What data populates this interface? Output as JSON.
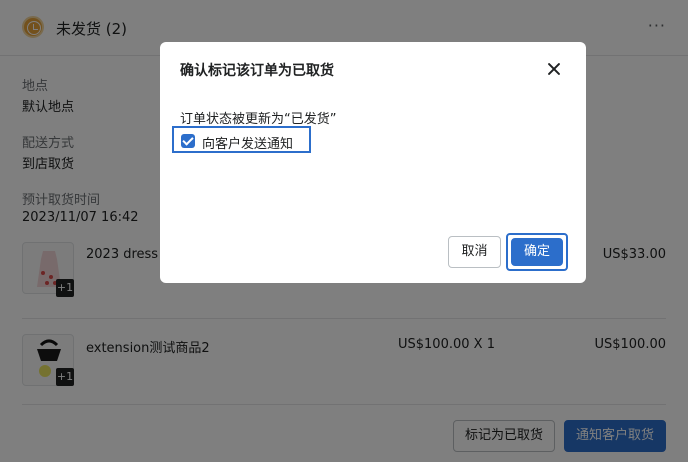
{
  "header": {
    "title": "未发货 (2)",
    "more_icon": "more-horizontal-icon",
    "status_icon": "clock-icon"
  },
  "fields": [
    {
      "label": "地点",
      "value": "默认地点"
    },
    {
      "label": "配送方式",
      "value": "到店取货"
    },
    {
      "label": "预计取货时间",
      "value": "2023/11/07 16:42"
    }
  ],
  "items": [
    {
      "name": "2023 dress",
      "qty": "",
      "total": "US$33.00",
      "badge": "+1"
    },
    {
      "name": "extension测试商品2",
      "qty": "US$100.00 X 1",
      "total": "US$100.00",
      "badge": "+1"
    }
  ],
  "footer": {
    "mark_button": "标记为已取货",
    "notify_button": "通知客户取货"
  },
  "modal": {
    "title": "确认标记该订单为已取货",
    "description": "订单状态被更新为“已发货”",
    "checkbox_label": "向客户发送通知",
    "checkbox_checked": true,
    "cancel_label": "取消",
    "confirm_label": "确定"
  },
  "colors": {
    "primary": "#2c6ecb",
    "overlay": "rgba(0,0,0,0.5)",
    "status": "#e6a33a"
  }
}
